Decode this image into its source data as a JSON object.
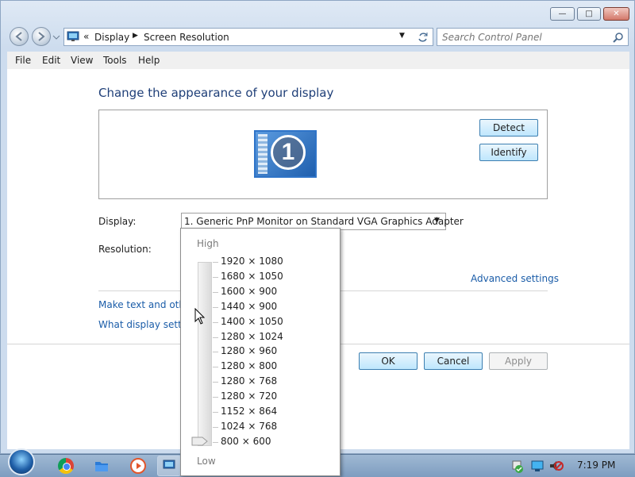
{
  "window": {
    "minimize_glyph": "—",
    "maximize_glyph": "□",
    "close_glyph": "✕"
  },
  "breadcrumb": {
    "items": [
      "Display",
      "Screen Resolution"
    ]
  },
  "search": {
    "placeholder": "Search Control Panel"
  },
  "menu": [
    "File",
    "Edit",
    "View",
    "Tools",
    "Help"
  ],
  "main": {
    "heading": "Change the appearance of your display",
    "monitor_number": "1",
    "detect_label": "Detect",
    "identify_label": "Identify",
    "display_label": "Display:",
    "display_value": "1. Generic PnP Monitor on Standard VGA Graphics Adapter",
    "resolution_label": "Resolution:",
    "advanced_link": "Advanced settings",
    "make_text_link": "Make text and other",
    "what_display_link": "What display setting",
    "ok_label": "OK",
    "cancel_label": "Cancel",
    "apply_label": "Apply"
  },
  "resolution_popup": {
    "high_label": "High",
    "low_label": "Low",
    "options": [
      "1920 × 1080",
      "1680 × 1050",
      "1600 × 900",
      "1440 × 900",
      "1400 × 1050",
      "1280 × 1024",
      "1280 × 960",
      "1280 × 800",
      "1280 × 768",
      "1280 × 720",
      "1152 × 864",
      "1024 × 768",
      "800 × 600"
    ],
    "selected": "800 × 600"
  },
  "taskbar": {
    "clock": "7:19 PM"
  },
  "colors": {
    "link": "#1a5ca8",
    "heading": "#1f3f78",
    "taskbar": "#8eabcb"
  }
}
